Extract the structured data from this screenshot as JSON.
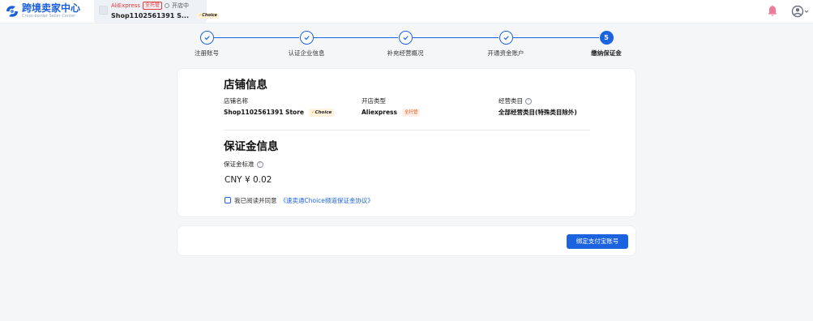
{
  "header": {
    "logo_title": "跨境卖家中心",
    "logo_subtitle": "Cross-border Seller Center",
    "shop": {
      "platform": "AliExpress",
      "badge": "全托管",
      "status": "开店中",
      "name_truncated": "Shop1102561391 S...",
      "choice_label": "Choice"
    },
    "icons": {
      "notification": "bell-icon",
      "account": "user-icon"
    }
  },
  "steps": [
    {
      "label": "注册账号",
      "state": "done"
    },
    {
      "label": "认证企业信息",
      "state": "done"
    },
    {
      "label": "补充经营概况",
      "state": "done"
    },
    {
      "label": "开通资金账户",
      "state": "done"
    },
    {
      "label": "缴纳保证金",
      "state": "current",
      "number": "5"
    }
  ],
  "store_info": {
    "title": "店铺信息",
    "name_label": "店铺名称",
    "name_value": "Shop1102561391 Store",
    "choice_label": "Choice",
    "type_label": "开店类型",
    "type_value": "Aliexpress",
    "type_badge": "全托管",
    "category_label": "经营类目",
    "category_value": "全部经营类目(特殊类目除外)"
  },
  "deposit_info": {
    "title": "保证金信息",
    "standard_label": "保证金标准",
    "amount": "CNY ¥ 0.02",
    "agree_prefix": "我已阅读并同意",
    "agree_link": "《速卖通Choice频道保证金协议》",
    "agreed": false
  },
  "actions": {
    "bind_alipay": "绑定支付宝账号"
  },
  "colors": {
    "primary": "#1c63e0",
    "brand_red": "#e4393c",
    "badge_orange": "#f0561d",
    "choice_bg": "#fff2dc",
    "page_bg": "#f5f6f8"
  }
}
